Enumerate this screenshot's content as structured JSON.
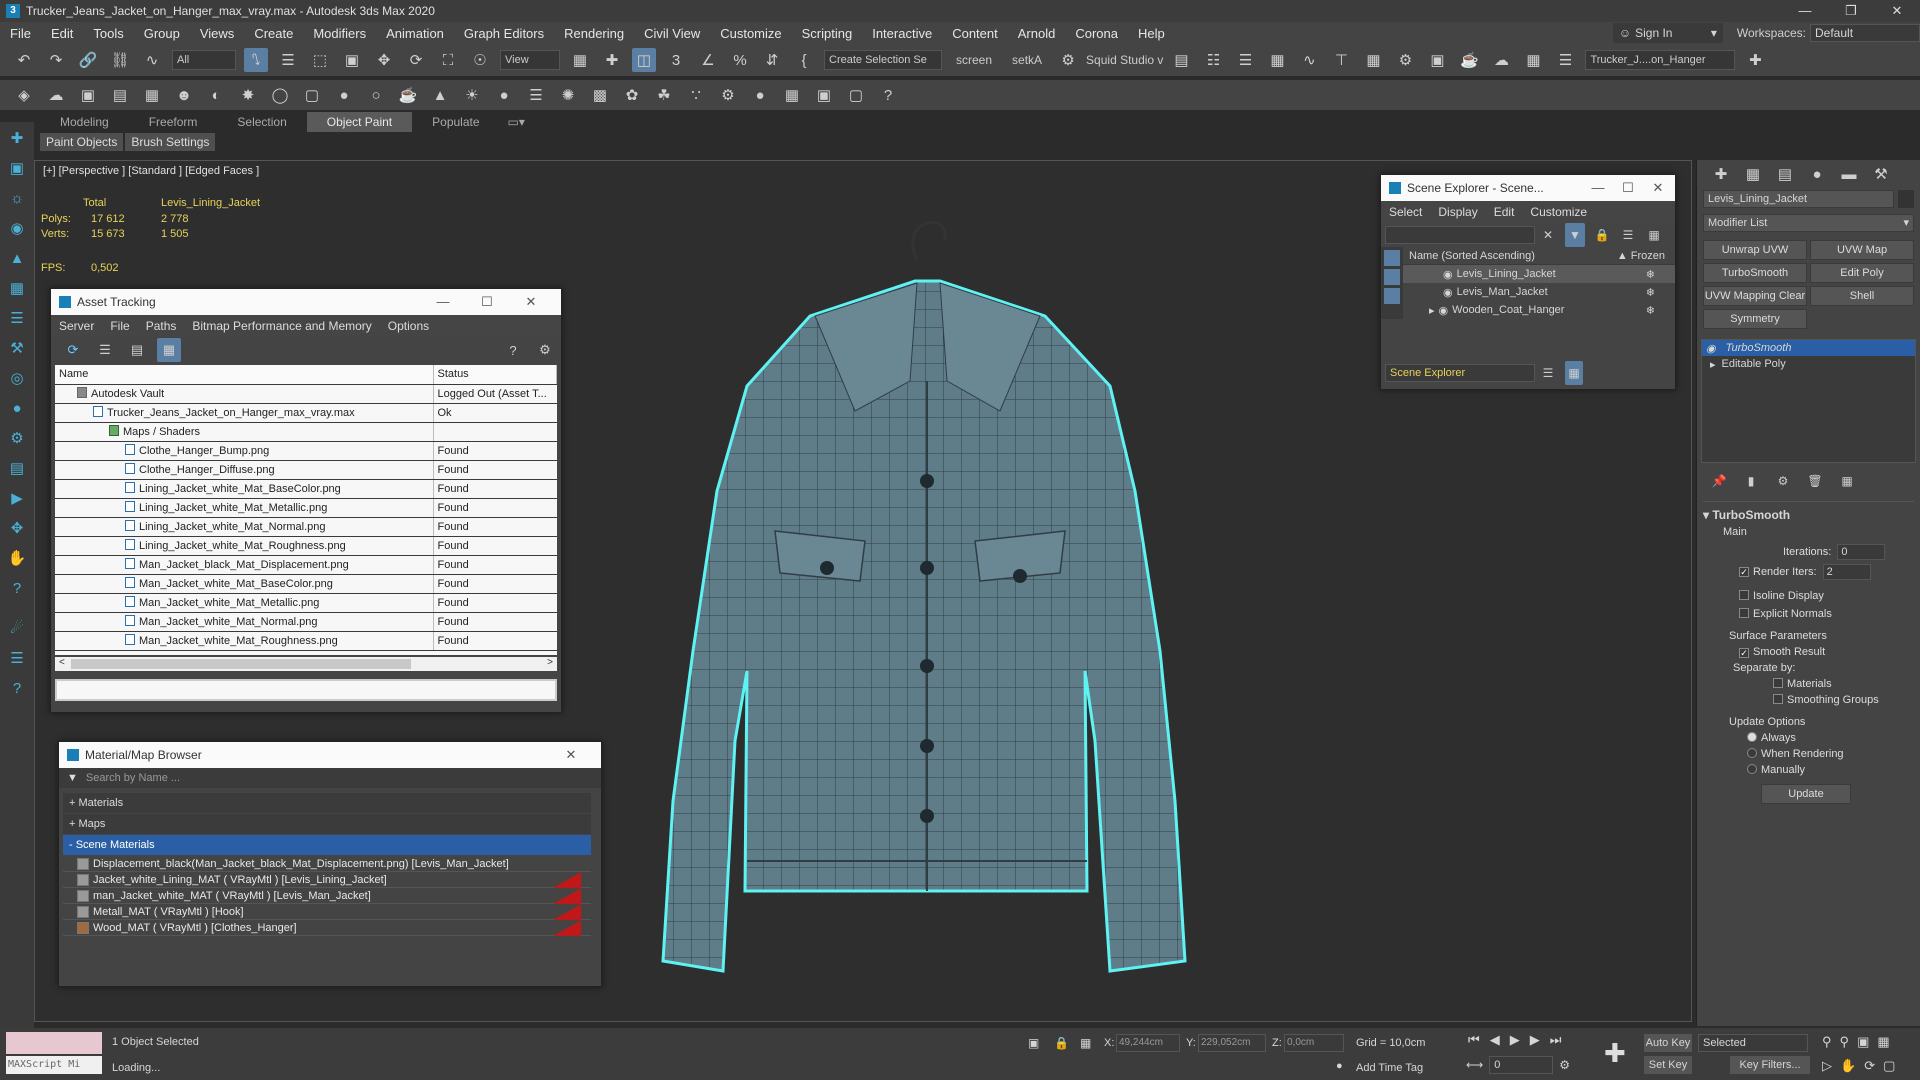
{
  "window": {
    "title": "Trucker_Jeans_Jacket_on_Hanger_max_vray.max - Autodesk 3ds Max 2020"
  },
  "menu": [
    "File",
    "Edit",
    "Tools",
    "Group",
    "Views",
    "Create",
    "Modifiers",
    "Animation",
    "Graph Editors",
    "Rendering",
    "Civil View",
    "Customize",
    "Scripting",
    "Interactive",
    "Content",
    "Arnold",
    "Corona",
    "Help"
  ],
  "account": {
    "signin": "Sign In",
    "workspaces_label": "Workspaces:",
    "workspace": "Default"
  },
  "toolbar": {
    "filter": "All",
    "view": "View",
    "selection_set": "Create Selection Se",
    "screen": "screen",
    "setka": "setkA",
    "squid": "Squid Studio v",
    "file_tab": "Trucker_J....on_Hanger"
  },
  "ribbon": {
    "tabs": [
      "Modeling",
      "Freeform",
      "Selection",
      "Object Paint",
      "Populate"
    ],
    "active": "Object Paint",
    "sub": [
      "Paint Objects",
      "Brush Settings"
    ]
  },
  "viewport": {
    "label": "[+] [Perspective ] [Standard ] [Edged Faces ]",
    "stats": {
      "total_label": "Total",
      "object": "Levis_Lining_Jacket",
      "polys_label": "Polys:",
      "polys_total": "17 612",
      "polys_obj": "2 778",
      "verts_label": "Verts:",
      "verts_total": "15 673",
      "verts_obj": "1 505",
      "fps_label": "FPS:",
      "fps": "0,502"
    }
  },
  "asset_tracking": {
    "title": "Asset Tracking",
    "menu": [
      "Server",
      "File",
      "Paths",
      "Bitmap Performance and Memory",
      "Options"
    ],
    "columns": [
      "Name",
      "Status"
    ],
    "rows": [
      {
        "name": "Autodesk Vault",
        "status": "Logged Out (Asset T..."
      },
      {
        "name": "Trucker_Jeans_Jacket_on_Hanger_max_vray.max",
        "status": "Ok"
      },
      {
        "name": "Maps / Shaders",
        "status": ""
      },
      {
        "name": "Clothe_Hanger_Bump.png",
        "status": "Found"
      },
      {
        "name": "Clothe_Hanger_Diffuse.png",
        "status": "Found"
      },
      {
        "name": "Lining_Jacket_white_Mat_BaseColor.png",
        "status": "Found"
      },
      {
        "name": "Lining_Jacket_white_Mat_Metallic.png",
        "status": "Found"
      },
      {
        "name": "Lining_Jacket_white_Mat_Normal.png",
        "status": "Found"
      },
      {
        "name": "Lining_Jacket_white_Mat_Roughness.png",
        "status": "Found"
      },
      {
        "name": "Man_Jacket_black_Mat_Displacement.png",
        "status": "Found"
      },
      {
        "name": "Man_Jacket_white_Mat_BaseColor.png",
        "status": "Found"
      },
      {
        "name": "Man_Jacket_white_Mat_Metallic.png",
        "status": "Found"
      },
      {
        "name": "Man_Jacket_white_Mat_Normal.png",
        "status": "Found"
      },
      {
        "name": "Man_Jacket_white_Mat_Roughness.png",
        "status": "Found"
      }
    ]
  },
  "material_browser": {
    "title": "Material/Map Browser",
    "search_placeholder": "Search by Name ...",
    "sections": [
      "+ Materials",
      "+ Maps",
      "- Scene Materials"
    ],
    "items": [
      "Displacement_black(Man_Jacket_black_Mat_Displacement.png) [Levis_Man_Jacket]",
      "Jacket_white_Lining_MAT ( VRayMtl ) [Levis_Lining_Jacket]",
      "man_Jacket_white_MAT ( VRayMtl ) [Levis_Man_Jacket]",
      "Metall_MAT ( VRayMtl ) [Hook]",
      "Wood_MAT ( VRayMtl ) [Clothes_Hanger]"
    ]
  },
  "scene_explorer": {
    "title": "Scene Explorer - Scene...",
    "menu": [
      "Select",
      "Display",
      "Edit",
      "Customize"
    ],
    "col_name": "Name (Sorted Ascending)",
    "col_frozen": "▲ Frozen",
    "items": [
      "Levis_Lining_Jacket",
      "Levis_Man_Jacket",
      "Wooden_Coat_Hanger"
    ],
    "footer": "Scene Explorer"
  },
  "command_panel": {
    "object_name": "Levis_Lining_Jacket",
    "modifier_list": "Modifier List",
    "buttons": [
      "Unwrap UVW",
      "UVW Map",
      "TurboSmooth",
      "Edit Poly",
      "UVW Mapping Clear",
      "Shell",
      "Symmetry"
    ],
    "stack": [
      "TurboSmooth",
      "Editable Poly"
    ],
    "rollout": "TurboSmooth",
    "main": "Main",
    "iterations_label": "Iterations:",
    "iterations": "0",
    "render_iters_label": "Render Iters:",
    "render_iters": "2",
    "isoline": "Isoline Display",
    "explicit": "Explicit Normals",
    "surface": "Surface Parameters",
    "smooth": "Smooth Result",
    "separate": "Separate by:",
    "materials": "Materials",
    "smoothing": "Smoothing Groups",
    "update_opts": "Update Options",
    "always": "Always",
    "when_rendering": "When Rendering",
    "manually": "Manually",
    "update": "Update"
  },
  "status": {
    "maxscript": "MAXScript Mi",
    "selected": "1 Object Selected",
    "loading": "Loading...",
    "x_label": "X:",
    "x": "49,244cm",
    "y_label": "Y:",
    "y": "229,052cm",
    "z_label": "Z:",
    "z": "0,0cm",
    "grid": "Grid = 10,0cm",
    "add_time_tag": "Add Time Tag",
    "auto_key": "Auto Key",
    "set_key": "Set Key",
    "selected_drop": "Selected",
    "key_filters": "Key Filters...",
    "frame": "0"
  }
}
